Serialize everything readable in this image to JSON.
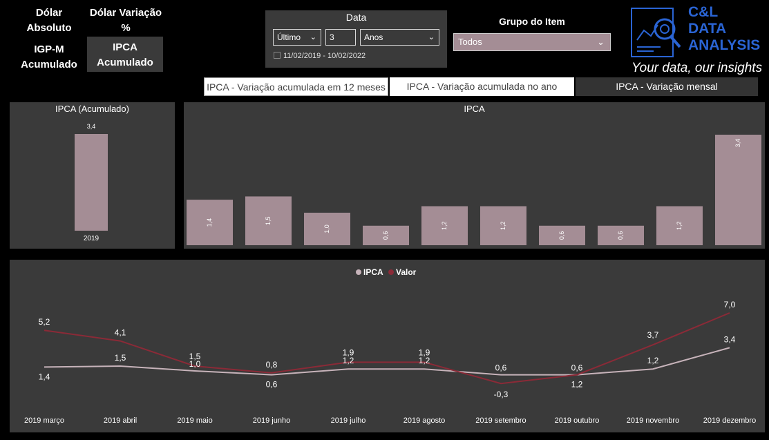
{
  "nav": {
    "dolar_absoluto": "Dólar Absoluto",
    "dolar_variacao": "Dólar Variação %",
    "igpm": "IGP-M Acumulado",
    "ipca": "IPCA Acumulado"
  },
  "date_filter": {
    "title": "Data",
    "mode": "Último",
    "amount": "3",
    "unit": "Anos",
    "range": "11/02/2019 - 10/02/2022"
  },
  "grupo": {
    "title": "Grupo do Item",
    "value": "Todos"
  },
  "tabs": [
    "IPCA - Variação acumulada em 12 meses",
    "IPCA - Variação acumulada no ano",
    "IPCA - Variação mensal"
  ],
  "logo": {
    "line1": "C&L",
    "line2": "DATA",
    "line3": "ANALYSIS",
    "tagline": "Your data, our insights"
  },
  "colors": {
    "bar": "#a48d95",
    "ipca_line": "#c7b3ba",
    "valor_line": "#8b2a37",
    "panel": "#3a3a3a",
    "logo": "#2a64d4"
  },
  "chart_data": [
    {
      "type": "bar",
      "title": "IPCA (Acumulado)",
      "categories": [
        "2019"
      ],
      "values": [
        3.4
      ],
      "labels": [
        "3,4"
      ]
    },
    {
      "type": "bar",
      "title": "IPCA",
      "categories": [
        "2019 março",
        "2019 abril",
        "2019 maio",
        "2019 junho",
        "2019 julho",
        "2019 agosto",
        "2019 setembro",
        "2019 outubro",
        "2019 novembro",
        "2019 dezembro"
      ],
      "values": [
        1.4,
        1.5,
        1.0,
        0.6,
        1.2,
        1.2,
        0.6,
        0.6,
        1.2,
        3.4
      ],
      "labels": [
        "1,4",
        "1,5",
        "1,0",
        "0,6",
        "1,2",
        "1,2",
        "0,6",
        "0,6",
        "1,2",
        "3,4"
      ]
    },
    {
      "type": "line",
      "legend": [
        "IPCA",
        "Valor"
      ],
      "legend_position": "top-center",
      "categories": [
        "2019 março",
        "2019 abril",
        "2019 maio",
        "2019 junho",
        "2019 julho",
        "2019 agosto",
        "2019 setembro",
        "2019 outubro",
        "2019 novembro",
        "2019 dezembro"
      ],
      "series": [
        {
          "name": "IPCA",
          "values": [
            1.4,
            1.5,
            1.0,
            0.6,
            1.2,
            1.2,
            0.6,
            0.6,
            1.2,
            3.4
          ],
          "labels": [
            "1,4",
            "1,5",
            "1,0",
            "0,6",
            "1,2",
            "1,2",
            "0,6",
            "1,2",
            "1,2",
            "3,4"
          ]
        },
        {
          "name": "Valor",
          "values": [
            5.2,
            4.1,
            1.5,
            0.8,
            1.9,
            1.9,
            -0.3,
            0.6,
            3.7,
            7.0
          ],
          "labels": [
            "5,2",
            "4,1",
            "1,5",
            "0,8",
            "1,9",
            "1,9",
            "-0,3",
            "0,6",
            "3,7",
            "7,0"
          ]
        }
      ]
    }
  ]
}
